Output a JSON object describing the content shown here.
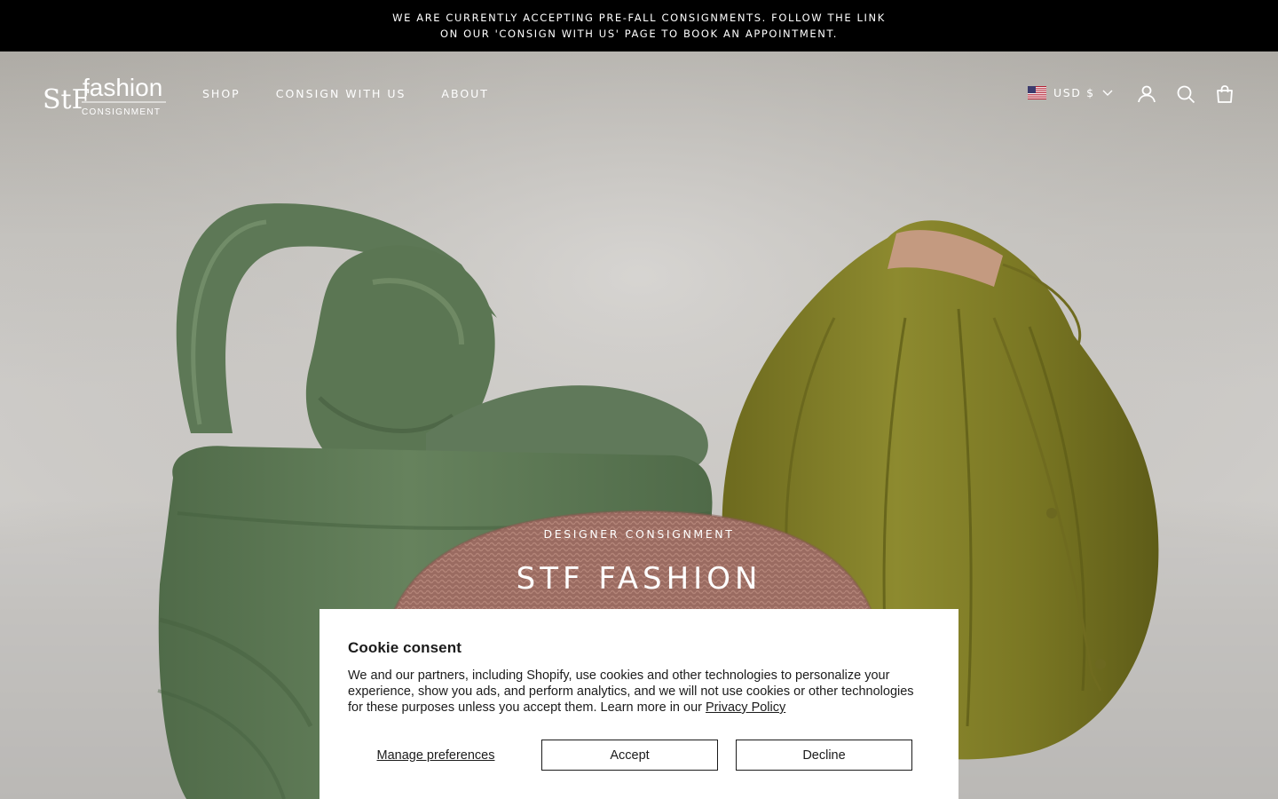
{
  "announcement": {
    "line1": "WE ARE CURRENTLY ACCEPTING PRE-FALL CONSIGNMENTS. FOLLOW THE LINK",
    "line2": "ON OUR 'CONSIGN WITH US' PAGE TO BOOK AN APPOINTMENT."
  },
  "header": {
    "logo": {
      "mark": "StF",
      "word": "fashion",
      "sub": "CONSIGNMENT"
    },
    "nav": [
      {
        "label": "SHOP"
      },
      {
        "label": "CONSIGN WITH US"
      },
      {
        "label": "ABOUT"
      }
    ],
    "currency": {
      "label": "USD $",
      "flag_icon": "us-flag-icon"
    },
    "icons": [
      "account-icon",
      "search-icon",
      "cart-bag-icon"
    ]
  },
  "hero": {
    "eyebrow": "DESIGNER CONSIGNMENT",
    "title": "STF FASHION"
  },
  "cookie": {
    "title": "Cookie consent",
    "body": "We and our partners, including Shopify, use cookies and other technologies to personalize your experience, show you ads, and perform analytics, and we will not use cookies or other technologies for these purposes unless you accept them. Learn more in our ",
    "policy_link": "Privacy Policy",
    "manage_label": "Manage preferences",
    "accept_label": "Accept",
    "decline_label": "Decline"
  },
  "colors": {
    "announcement_bg": "#000000",
    "header_text": "#ffffff",
    "green_bag": "#5f7a57",
    "olive_bag": "#7d7a26",
    "pink_bag": "#9a6b61"
  }
}
